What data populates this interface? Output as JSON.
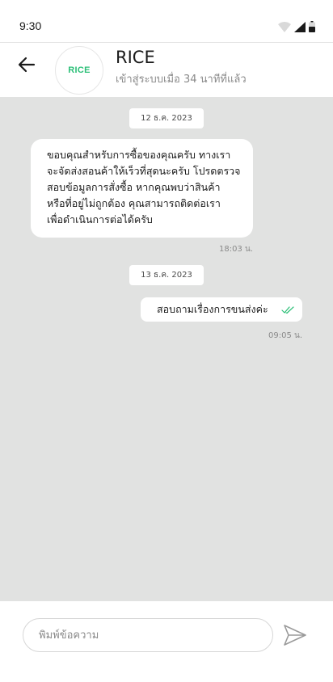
{
  "status_bar": {
    "time": "9:30"
  },
  "header": {
    "contact_name": "RICE",
    "avatar_logo": "RICE",
    "last_seen": "เข้าสู่ระบบเมื่อ 34 นาทีที่แล้ว"
  },
  "chat": {
    "date_1": "12 ธ.ค. 2023",
    "incoming_lines": [
      "ขอบคุณสำหรับการซื้อของคุณครับ ทางเรา",
      "จะจัดส่งสอนค้าให้เร็วที่สุดนะครับ โปรดตรวจ",
      "สอบข้อมูลการสั่งซื้อ หากคุณพบว่าสินค้า",
      "หรือที่อยู่ไม่ถูกต้อง คุณสามารถติดต่อเรา",
      "เพื่อดำเนินการต่อได้ครับ"
    ],
    "incoming_time": "18:03 น.",
    "date_2": "13 ธ.ค. 2023",
    "outgoing_text": "สอบถามเรื่องการขนส่งค่ะ",
    "outgoing_time": "09:05 น."
  },
  "input": {
    "placeholder": "พิมพ์ข้อความ"
  },
  "colors": {
    "accent": "#2bbf77",
    "chat_bg": "#e1e2e1",
    "read_check": "#2bbf77"
  }
}
